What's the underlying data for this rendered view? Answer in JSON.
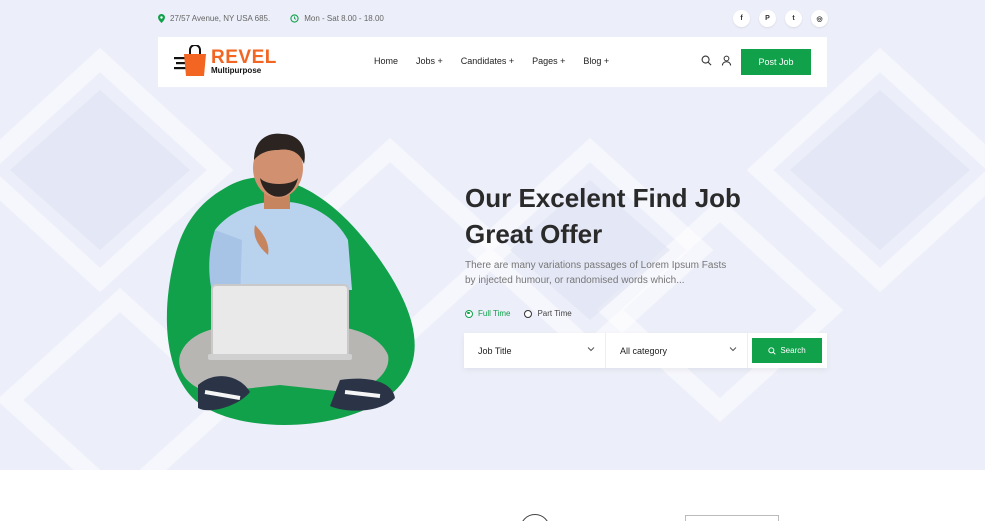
{
  "topbar": {
    "address": "27/57 Avenue, NY USA 685.",
    "hours": "Mon - Sat 8.00 - 18.00",
    "socials": [
      {
        "icon": "facebook-icon",
        "glyph": "f"
      },
      {
        "icon": "pinterest-icon",
        "glyph": "P"
      },
      {
        "icon": "twitter-icon",
        "glyph": "t"
      },
      {
        "icon": "instagram-icon",
        "glyph": "◎"
      }
    ]
  },
  "header": {
    "logo_name": "REVEL",
    "logo_sub": "Multipurpose",
    "nav": [
      "Home",
      "Jobs +",
      "Candidates +",
      "Pages +",
      "Blog +"
    ],
    "post_job": "Post Job"
  },
  "hero": {
    "title_line1": "Our Excelent Find Job",
    "title_line2": "Great Offer",
    "desc_line1": "There are many variations passages of Lorem Ipsum Fasts",
    "desc_line2": "by injected humour, or randomised words which...",
    "radios": [
      {
        "label": "Full Time",
        "selected": true
      },
      {
        "label": "Part Time",
        "selected": false
      }
    ],
    "search": {
      "job_title": "Job Title",
      "category": "All category",
      "button": "Search"
    }
  },
  "colors": {
    "accent": "#10a14a",
    "brand": "#f26522",
    "background": "#eceef9"
  }
}
